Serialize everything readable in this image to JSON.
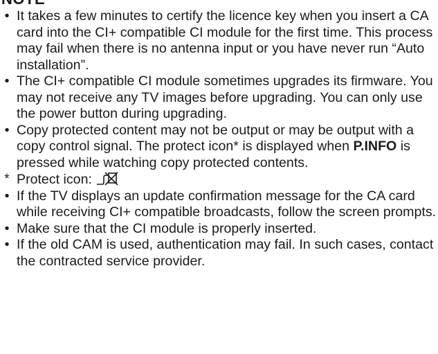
{
  "heading": "NOTE",
  "bullets": {
    "b1": "It takes a few minutes to certify the licence key when you insert a CA card into the CI+ compatible CI module for the first time. This process may fail when there is no antenna input or you have never run “Auto installation”.",
    "b2": "The CI+ compatible CI module sometimes upgrades its firmware. You may not receive any TV images before upgrading. You can only use the power button during upgrading.",
    "b3_before": "Copy protected content may not be output or may be output with a copy control signal. The protect icon* is displayed when ",
    "b3_key": "P.INFO",
    "b3_after": " is pressed while watching copy protected contents.",
    "footnote_mark": "*",
    "footnote_label": "Protect icon:",
    "b4": "If the TV displays an update confirmation message for the CA card while receiving CI+ compatible broadcasts, follow the screen prompts.",
    "b5": "Make sure that the CI module is properly inserted.",
    "b6": "If the old CAM is used, authentication may fail. In such cases, contact the contracted service provider."
  },
  "bullet_char": "•",
  "protect_icon_name": "protect-icon"
}
